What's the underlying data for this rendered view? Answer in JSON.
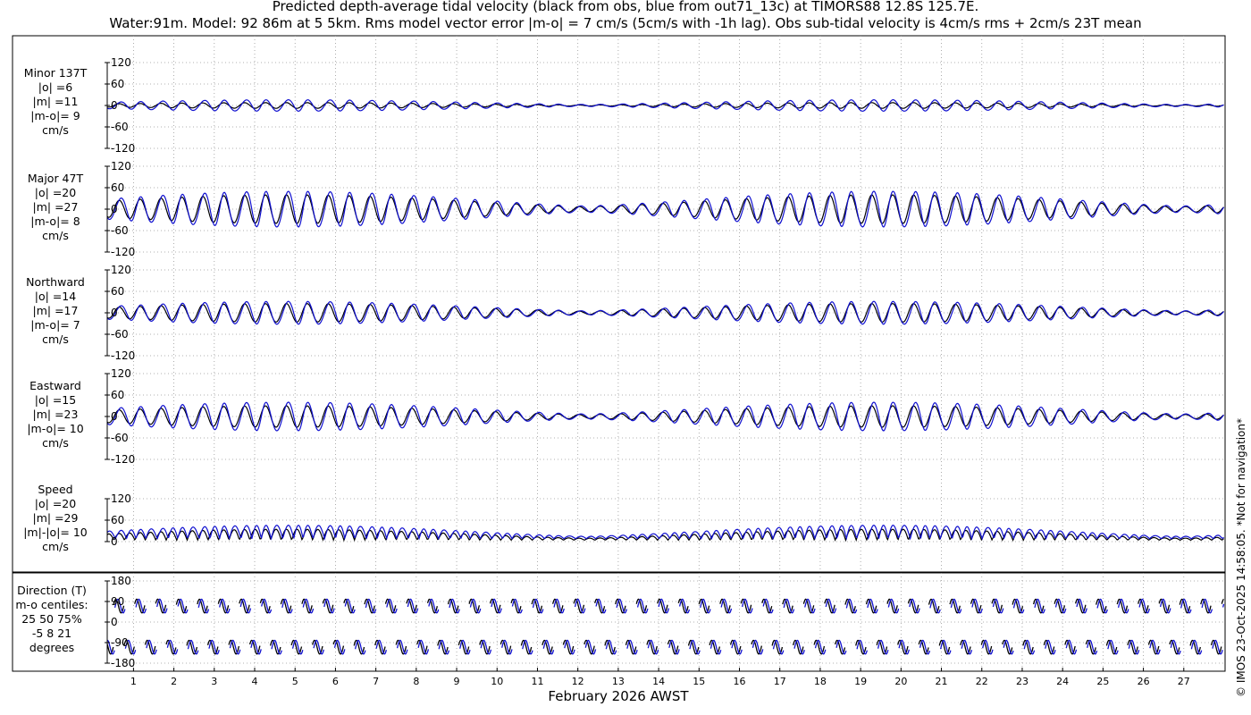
{
  "title_line1": "Predicted depth-average tidal velocity (black from obs, blue from out71_13c) at TIMORS88 12.8S 125.7E.",
  "title_line2": "Water:91m. Model: 92 86m at 5 5km. Rms model vector error |m-o| = 7 cm/s (5cm/s with -1h lag). Obs sub-tidal velocity is 4cm/s rms + 2cm/s 23T mean",
  "footer_note": "© IMOS 23-Oct-2025 14:58:05. *Not for navigation*",
  "colors": {
    "obs": "#000000",
    "model": "#1010d0",
    "grid": "#999999"
  },
  "chart_data": {
    "type": "line",
    "xlabel": "February 2026 AWST",
    "x_ticks": [
      "1",
      "2",
      "3",
      "4",
      "5",
      "6",
      "7",
      "8",
      "9",
      "10",
      "11",
      "12",
      "13",
      "14",
      "15",
      "16",
      "17",
      "18",
      "19",
      "20",
      "21",
      "22",
      "23",
      "24",
      "25",
      "26",
      "27"
    ],
    "x_range_days": [
      0.35,
      28
    ],
    "series_names": [
      "obs",
      "model"
    ],
    "panels": [
      {
        "name": "minor",
        "label_lines": [
          "Minor 137T",
          "|o| =6",
          "|m| =11",
          "|m-o|= 9",
          "cm/s"
        ],
        "ylim": [
          -120,
          120
        ],
        "yticks": [
          "120",
          "60",
          "0",
          "-60",
          "-120"
        ],
        "tick_values": [
          120,
          60,
          0,
          -60,
          -120
        ],
        "obs_amp": 8,
        "model_amp": 16
      },
      {
        "name": "major",
        "label_lines": [
          "Major 47T",
          "|o| =20",
          "|m| =27",
          "|m-o|= 8",
          "cm/s"
        ],
        "ylim": [
          -120,
          120
        ],
        "yticks": [
          "120",
          "60",
          "0",
          "-60",
          "-120"
        ],
        "tick_values": [
          120,
          60,
          0,
          -60,
          -120
        ],
        "obs_amp": 40,
        "model_amp": 50
      },
      {
        "name": "northward",
        "label_lines": [
          "Northward",
          "|o| =14",
          "|m| =17",
          "|m-o|= 7",
          "cm/s"
        ],
        "ylim": [
          -120,
          120
        ],
        "yticks": [
          "120",
          "60",
          "0",
          "-60",
          "-120"
        ],
        "tick_values": [
          120,
          60,
          0,
          -60,
          -120
        ],
        "obs_amp": 26,
        "model_amp": 32
      },
      {
        "name": "eastward",
        "label_lines": [
          "Eastward",
          "|o| =15",
          "|m| =23",
          "|m-o|= 10",
          "cm/s"
        ],
        "ylim": [
          -120,
          120
        ],
        "yticks": [
          "120",
          "60",
          "0",
          "-60",
          "-120"
        ],
        "tick_values": [
          120,
          60,
          0,
          -60,
          -120
        ],
        "obs_amp": 30,
        "model_amp": 40
      },
      {
        "name": "speed",
        "label_lines": [
          "Speed",
          "|o| =20",
          "|m| =29",
          "|m|-|o|= 10",
          "cm/s"
        ],
        "ylim": [
          0,
          120
        ],
        "yticks": [
          "120",
          "60",
          "0"
        ],
        "tick_values": [
          120,
          60,
          0
        ],
        "obs_amp": 34,
        "model_amp": 42
      },
      {
        "name": "direction",
        "label_lines": [
          "Direction (T)",
          "m-o centiles:",
          "25  50  75%",
          "-5   8  21",
          "degrees"
        ],
        "ylim": [
          -180,
          180
        ],
        "yticks": [
          "180",
          "90",
          "0",
          "-90",
          "-180"
        ],
        "tick_values": [
          180,
          90,
          0,
          -90,
          -180
        ],
        "obs_amp": 0,
        "model_amp": 0
      }
    ],
    "tidal_period_hours": 12.42,
    "spring_neap_period_days": 14.77
  }
}
